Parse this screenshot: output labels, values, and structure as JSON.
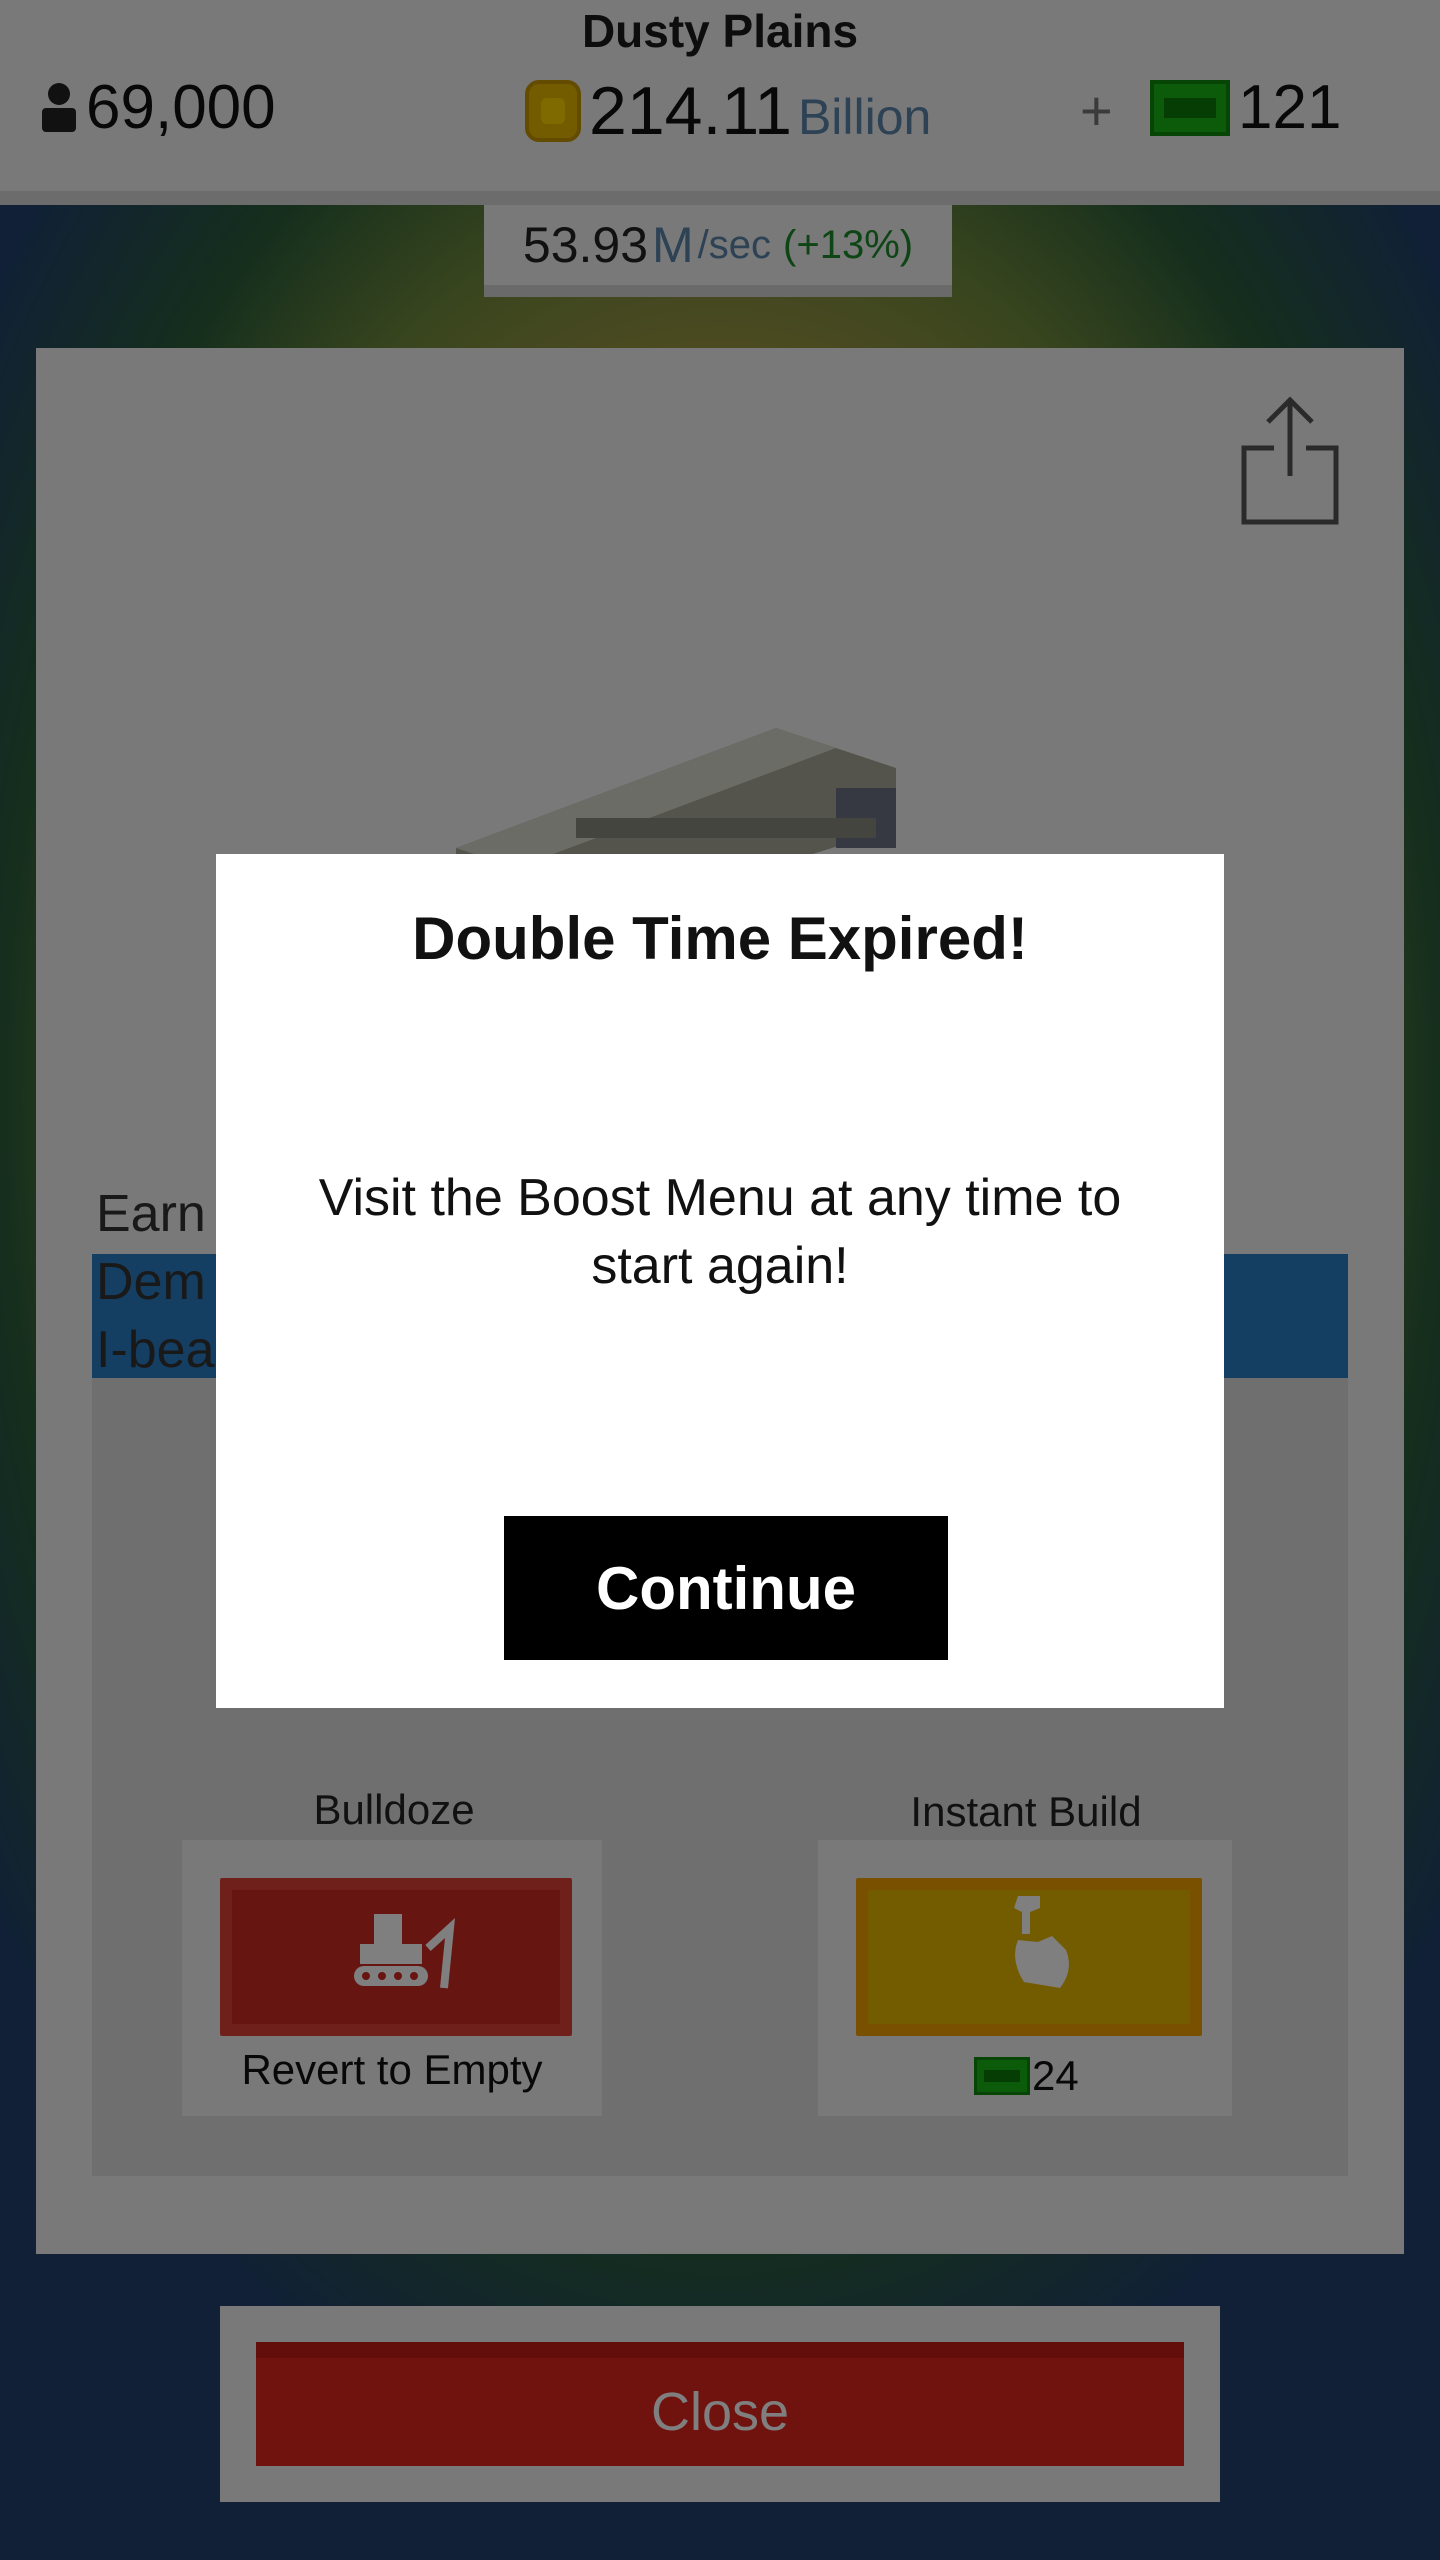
{
  "header": {
    "map_title": "Dusty Plains",
    "population": "69,000",
    "money_amount": "214.11",
    "money_unit": "Billion",
    "plus_label": "+",
    "bucks": "121"
  },
  "rate": {
    "value": "53.93",
    "multiplier": "M",
    "per": "/sec",
    "bonus": "(+13%)"
  },
  "building_panel": {
    "description_lines": [
      "Earn",
      "Dem",
      "I-beams sold: 61"
    ],
    "bulldoze": {
      "label": "Bulldoze",
      "caption": "Revert to Empty"
    },
    "instant_build": {
      "label": "Instant Build",
      "price": "24"
    }
  },
  "close_button": "Close",
  "modal": {
    "title": "Double Time Expired!",
    "message": "Visit the Boost Menu at any time to start again!",
    "continue_label": "Continue"
  },
  "colors": {
    "blue_bar": "#2a7dc6",
    "bulldoze_red": "#cc2a22",
    "instant_build_yellow": "#e6b800",
    "close_red": "#e0251c",
    "bux_green": "#17b617"
  }
}
